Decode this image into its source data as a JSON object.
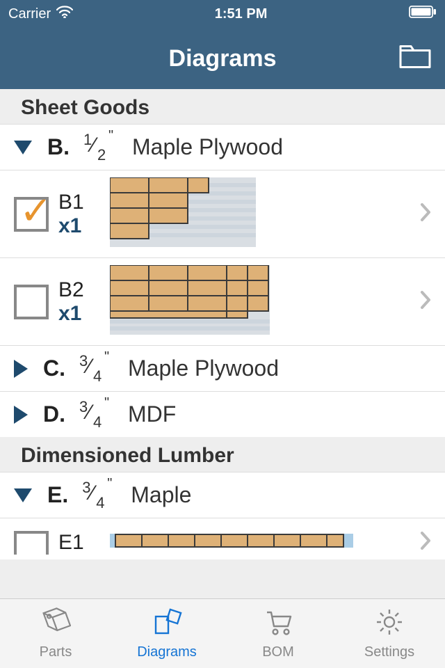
{
  "statusbar": {
    "carrier": "Carrier",
    "time": "1:51 PM"
  },
  "nav": {
    "title": "Diagrams"
  },
  "sections": [
    {
      "title": "Sheet Goods"
    },
    {
      "title": "Dimensioned Lumber"
    }
  ],
  "materials": {
    "B": {
      "letter": "B.",
      "frac_num": "1",
      "frac_den": "2",
      "name": "Maple Plywood"
    },
    "C": {
      "letter": "C.",
      "frac_num": "3",
      "frac_den": "4",
      "name": "Maple Plywood"
    },
    "D": {
      "letter": "D.",
      "frac_num": "3",
      "frac_den": "4",
      "name": "MDF"
    },
    "E": {
      "letter": "E.",
      "frac_num": "3",
      "frac_den": "4",
      "name": "Maple"
    }
  },
  "diagrams": {
    "B1": {
      "label": "B1",
      "qty": "x1",
      "checked": true
    },
    "B2": {
      "label": "B2",
      "qty": "x1",
      "checked": false
    },
    "E1": {
      "label": "E1",
      "qty": "",
      "checked": false
    }
  },
  "tabs": {
    "parts": "Parts",
    "diagrams": "Diagrams",
    "bom": "BOM",
    "settings": "Settings"
  }
}
